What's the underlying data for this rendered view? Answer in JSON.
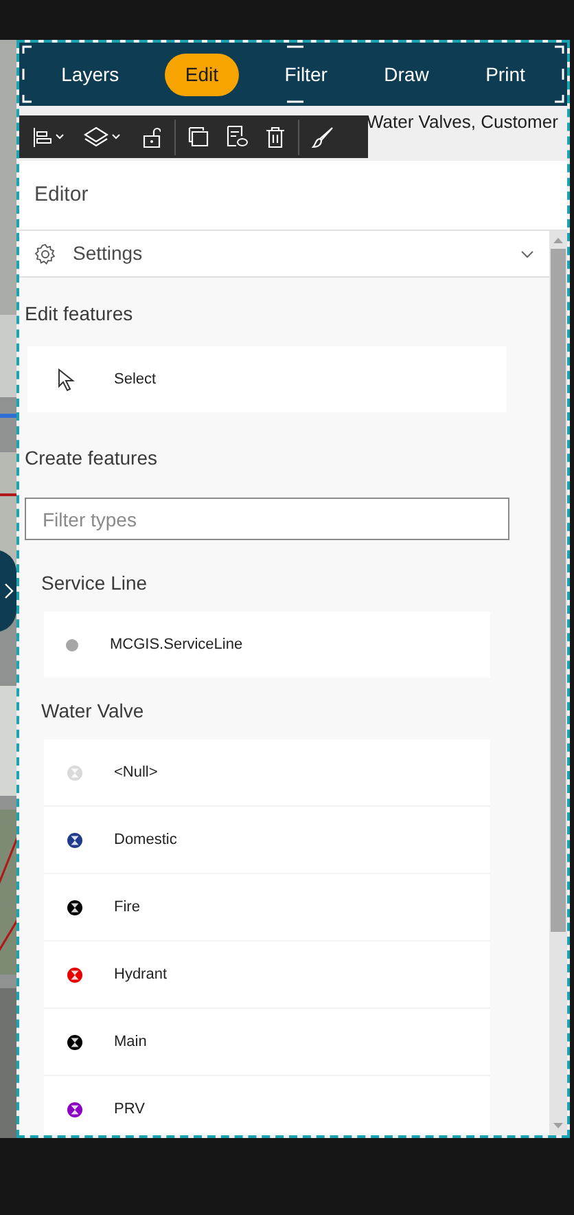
{
  "nav_tabs": [
    {
      "label": "Layers",
      "selected": false
    },
    {
      "label": "Edit",
      "selected": true
    },
    {
      "label": "Filter",
      "selected": false
    },
    {
      "label": "Draw",
      "selected": false
    },
    {
      "label": "Print",
      "selected": false
    }
  ],
  "layer_caption": "Water Valves, Customer",
  "editor": {
    "title": "Editor",
    "settings": {
      "label": "Settings",
      "expanded": false
    },
    "edit_features": {
      "heading": "Edit features",
      "tool": "Select"
    },
    "create_features": {
      "heading": "Create features",
      "filter": {
        "placeholder": "Filter types"
      },
      "groups": [
        {
          "name": "Service Line",
          "kind": "line",
          "items": [
            {
              "label": "MCGIS.ServiceLine",
              "color": "#a6a6a6"
            }
          ]
        },
        {
          "name": "Water Valve",
          "kind": "valve",
          "items": [
            {
              "label": "<Null>",
              "color": "#d9d9d9"
            },
            {
              "label": "Domestic",
              "color": "#1f3b8a"
            },
            {
              "label": "Fire",
              "color": "#000000"
            },
            {
              "label": "Hydrant",
              "color": "#e60000"
            },
            {
              "label": "Main",
              "color": "#000000"
            },
            {
              "label": "PRV",
              "color": "#8a00c2"
            }
          ]
        }
      ]
    }
  }
}
